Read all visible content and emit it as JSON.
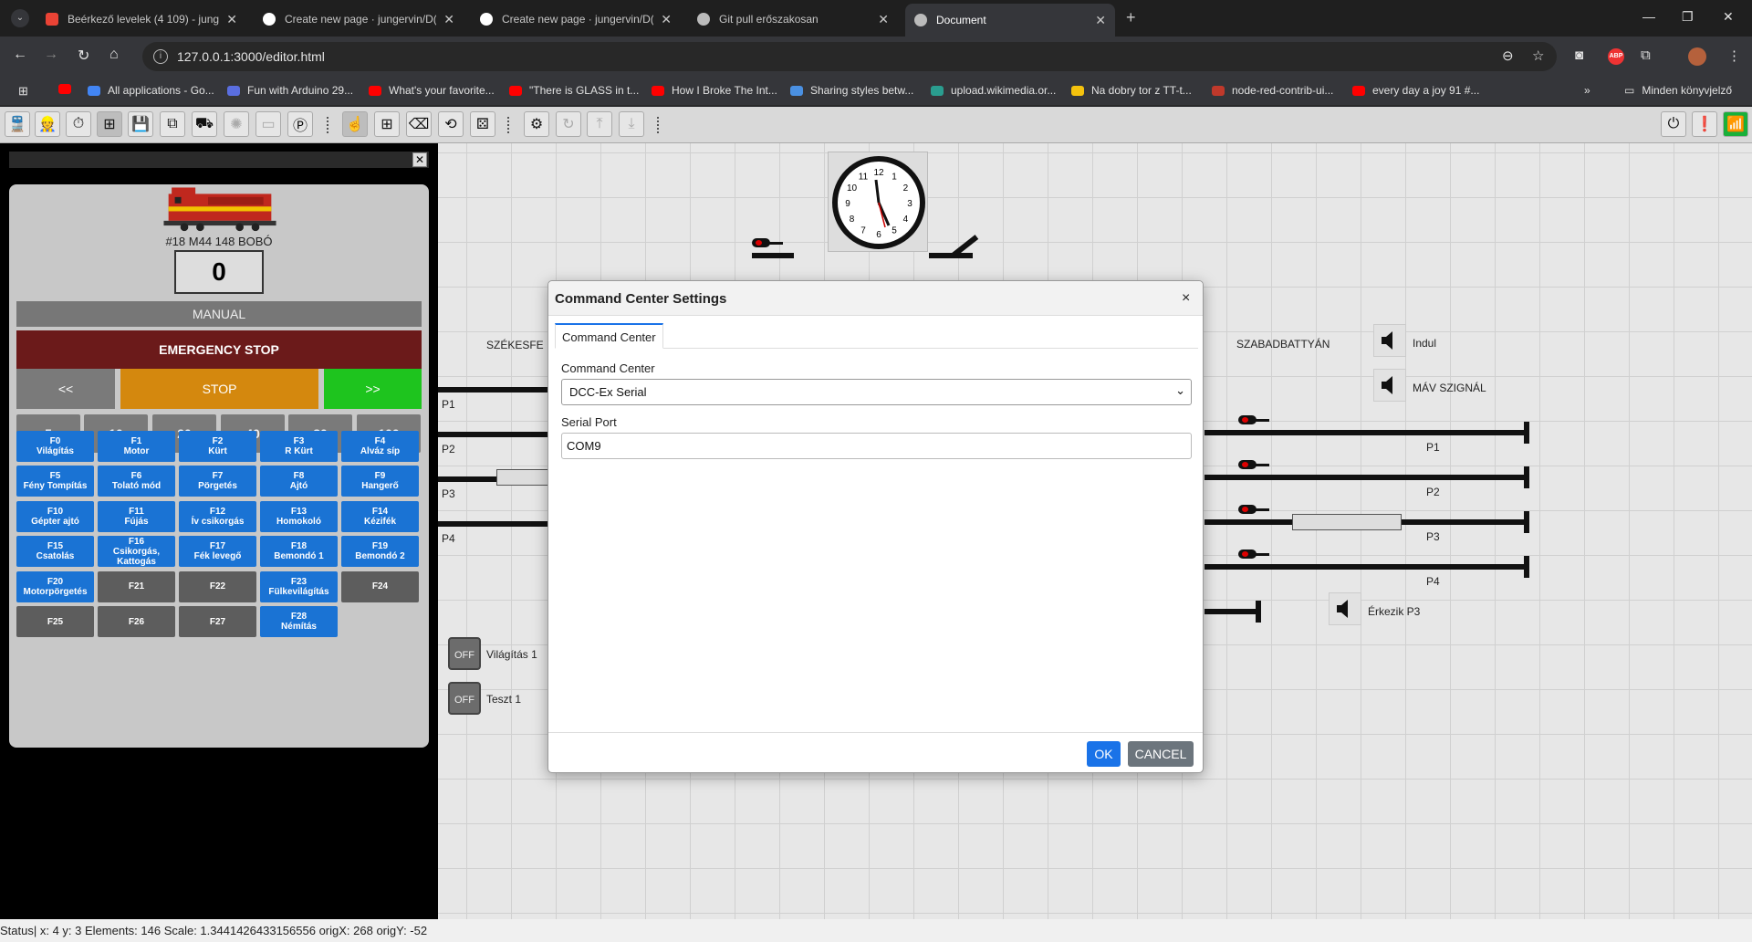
{
  "browser": {
    "tabs": [
      {
        "title": "Beérkező levelek (4 109) - jung",
        "icon_color": "#ea4335"
      },
      {
        "title": "Create new page · jungervin/D(",
        "icon_color": "#ffffff"
      },
      {
        "title": "Create new page · jungervin/D(",
        "icon_color": "#ffffff"
      },
      {
        "title": "Git pull erőszakosan",
        "icon_color": "#bbbbbb"
      },
      {
        "title": "Document",
        "icon_color": "#bbbbbb"
      }
    ],
    "url": "127.0.0.1:3000/editor.html",
    "bookmarks": [
      {
        "label": "",
        "color": "#ff0000"
      },
      {
        "label": "All applications - Go...",
        "color": "#4285f4"
      },
      {
        "label": "Fun with Arduino 29...",
        "color": "#5a6ee0"
      },
      {
        "label": "What's your favorite...",
        "color": "#ff0000"
      },
      {
        "label": "\"There is GLASS in t...",
        "color": "#ff0000"
      },
      {
        "label": "How I Broke The Int...",
        "color": "#ff0000"
      },
      {
        "label": "Sharing styles betw...",
        "color": "#4a90e2"
      },
      {
        "label": "upload.wikimedia.or...",
        "color": "#2a9d8f"
      },
      {
        "label": "Na dobry tor z TT-t...",
        "color": "#f4c20d"
      },
      {
        "label": "node-red-contrib-ui...",
        "color": "#c0392b"
      },
      {
        "label": "every day a joy 91 #...",
        "color": "#ff0000"
      }
    ],
    "bookmarks_folder": "Minden könyvjelző",
    "abp_label": "ABP"
  },
  "throttle": {
    "loco_name": "#18 M44 148 BOBÓ",
    "speed": "0",
    "mode": "MANUAL",
    "emergency_stop": "EMERGENCY STOP",
    "rev_label": "<<",
    "stop_label": "STOP",
    "fwd_label": ">>",
    "speed_steps": [
      "5",
      "10",
      "20",
      "40",
      "80",
      "100"
    ],
    "functions": [
      {
        "id": "F0",
        "name": "Világítás",
        "active": true
      },
      {
        "id": "F1",
        "name": "Motor",
        "active": true
      },
      {
        "id": "F2",
        "name": "Kürt",
        "active": true
      },
      {
        "id": "F3",
        "name": "R Kürt",
        "active": true
      },
      {
        "id": "F4",
        "name": "Alváz síp",
        "active": true
      },
      {
        "id": "F5",
        "name": "Fény Tompítás",
        "active": true
      },
      {
        "id": "F6",
        "name": "Tolató mód",
        "active": true
      },
      {
        "id": "F7",
        "name": "Pörgetés",
        "active": true
      },
      {
        "id": "F8",
        "name": "Ajtó",
        "active": true
      },
      {
        "id": "F9",
        "name": "Hangerő",
        "active": true
      },
      {
        "id": "F10",
        "name": "Gépter ajtó",
        "active": true
      },
      {
        "id": "F11",
        "name": "Fújás",
        "active": true
      },
      {
        "id": "F12",
        "name": "Ív csikorgás",
        "active": true
      },
      {
        "id": "F13",
        "name": "Homokoló",
        "active": true
      },
      {
        "id": "F14",
        "name": "Kézifék",
        "active": true
      },
      {
        "id": "F15",
        "name": "Csatolás",
        "active": true
      },
      {
        "id": "F16",
        "name": "Csikorgás, Kattogás",
        "active": true
      },
      {
        "id": "F17",
        "name": "Fék levegő",
        "active": true
      },
      {
        "id": "F18",
        "name": "Bemondó 1",
        "active": true
      },
      {
        "id": "F19",
        "name": "Bemondó 2",
        "active": true
      },
      {
        "id": "F20",
        "name": "Motorpörgetés",
        "active": true
      },
      {
        "id": "F21",
        "name": "",
        "active": false
      },
      {
        "id": "F22",
        "name": "",
        "active": false
      },
      {
        "id": "F23",
        "name": "Fülkevilágítás",
        "active": true
      },
      {
        "id": "F24",
        "name": "",
        "active": false
      },
      {
        "id": "F25",
        "name": "",
        "active": false
      },
      {
        "id": "F26",
        "name": "",
        "active": false
      },
      {
        "id": "F27",
        "name": "",
        "active": false
      },
      {
        "id": "F28",
        "name": "Némítás",
        "active": true
      }
    ]
  },
  "layout": {
    "stations": [
      "SZÉKESFE",
      "SZABADBATTYÁN"
    ],
    "left_tracks": [
      "P1",
      "P2",
      "P3",
      "P4"
    ],
    "right_tracks": [
      "P1",
      "P2",
      "P3",
      "P4"
    ],
    "sounds": [
      "Indul",
      "MÁV SZIGNÁL",
      "Érkezik P3"
    ],
    "toggles": [
      {
        "state": "OFF",
        "label": "Világítás 1"
      },
      {
        "state": "OFF",
        "label": "Teszt 1"
      }
    ],
    "clock_numbers": [
      "12",
      "1",
      "2",
      "3",
      "4",
      "5",
      "6",
      "7",
      "8",
      "9",
      "10",
      "11"
    ]
  },
  "dialog": {
    "title": "Command Center Settings",
    "close": "×",
    "tab": "Command Center",
    "cc_label": "Command Center",
    "cc_value": "DCC-Ex Serial",
    "port_label": "Serial Port",
    "port_value": "COM9",
    "ok": "OK",
    "cancel": "CANCEL"
  },
  "status": "Status| x: 4 y: 3 Elements: 146 Scale: 1.3441426433156556 origX: 268 origY: -52"
}
